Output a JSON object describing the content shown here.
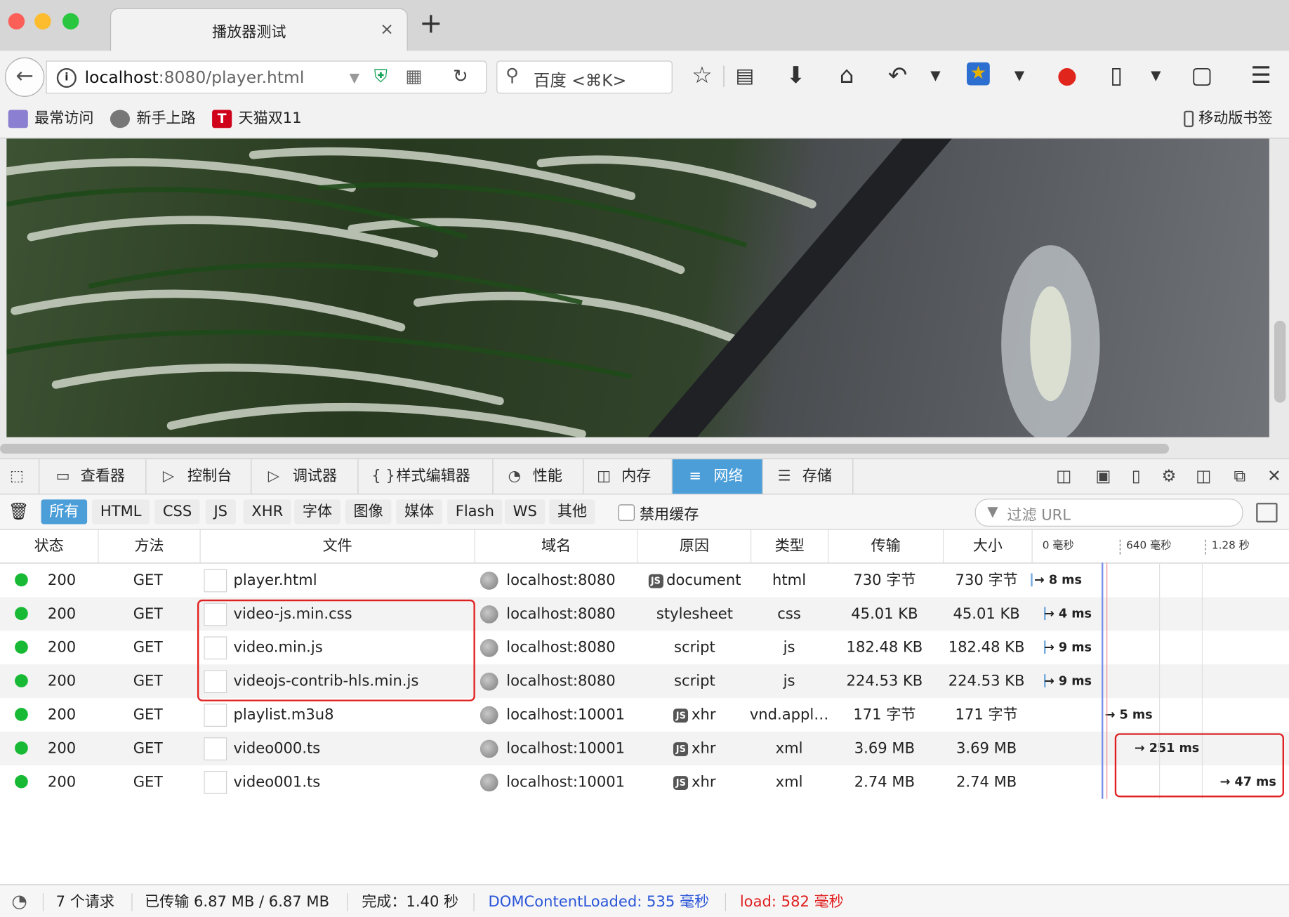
{
  "window": {
    "tab_title": "播放器测试",
    "tab_close": "×",
    "new_tab": "+"
  },
  "navbar": {
    "url_host": "localhost",
    "url_rest": ":8080/player.html",
    "search_placeholder": "百度 <⌘K>",
    "icons": [
      "back-icon",
      "info-icon",
      "dropdown-icon",
      "shield-icon",
      "qr-code-icon",
      "reload-icon",
      "star-icon",
      "reading-list-icon",
      "download-icon",
      "home-icon",
      "undo-icon",
      "favorites-icon",
      "color-extension-icon",
      "clipboard-icon",
      "crop-icon",
      "menu-icon"
    ]
  },
  "bookmarks": {
    "items": [
      "最常访问",
      "新手上路",
      "天猫双11"
    ],
    "mobile": "移动版书签"
  },
  "devtools": {
    "tabs": [
      {
        "label": "查看器",
        "icon": "inspector-icon"
      },
      {
        "label": "控制台",
        "icon": "console-icon"
      },
      {
        "label": "调试器",
        "icon": "debugger-icon"
      },
      {
        "label": "样式编辑器",
        "icon": "style-editor-icon"
      },
      {
        "label": "性能",
        "icon": "performance-icon"
      },
      {
        "label": "内存",
        "icon": "memory-icon"
      },
      {
        "label": "网络",
        "icon": "network-icon"
      },
      {
        "label": "存储",
        "icon": "storage-icon"
      }
    ],
    "active_tab": "网络",
    "filters": [
      "所有",
      "HTML",
      "CSS",
      "JS",
      "XHR",
      "字体",
      "图像",
      "媒体",
      "Flash",
      "WS",
      "其他"
    ],
    "disable_cache_label": "禁用缓存",
    "filter_placeholder": "过滤 URL",
    "columns": [
      "状态",
      "方法",
      "文件",
      "域名",
      "原因",
      "类型",
      "传输",
      "大小"
    ],
    "timeline_ticks": [
      "0 毫秒",
      "640 毫秒",
      "1.28 秒"
    ],
    "requests": [
      {
        "status": "200",
        "method": "GET",
        "file": "player.html",
        "domain": "localhost:8080",
        "cause": "document",
        "cause_js": true,
        "type": "html",
        "transferred": "730 字节",
        "size": "730 字节",
        "timing": "→ 8 ms"
      },
      {
        "status": "200",
        "method": "GET",
        "file": "video-js.min.css",
        "domain": "localhost:8080",
        "cause": "stylesheet",
        "cause_js": false,
        "type": "css",
        "transferred": "45.01 KB",
        "size": "45.01 KB",
        "timing": "→ 4 ms"
      },
      {
        "status": "200",
        "method": "GET",
        "file": "video.min.js",
        "domain": "localhost:8080",
        "cause": "script",
        "cause_js": false,
        "type": "js",
        "transferred": "182.48 KB",
        "size": "182.48 KB",
        "timing": "→ 9 ms"
      },
      {
        "status": "200",
        "method": "GET",
        "file": "videojs-contrib-hls.min.js",
        "domain": "localhost:8080",
        "cause": "script",
        "cause_js": false,
        "type": "js",
        "transferred": "224.53 KB",
        "size": "224.53 KB",
        "timing": "→ 9 ms"
      },
      {
        "status": "200",
        "method": "GET",
        "file": "playlist.m3u8",
        "domain": "localhost:10001",
        "cause": "xhr",
        "cause_js": true,
        "type": "vnd.appl…",
        "transferred": "171 字节",
        "size": "171 字节",
        "timing": "→ 5 ms"
      },
      {
        "status": "200",
        "method": "GET",
        "file": "video000.ts",
        "domain": "localhost:10001",
        "cause": "xhr",
        "cause_js": true,
        "type": "xml",
        "transferred": "3.69 MB",
        "size": "3.69 MB",
        "timing": "→ 251 ms"
      },
      {
        "status": "200",
        "method": "GET",
        "file": "video001.ts",
        "domain": "localhost:10001",
        "cause": "xhr",
        "cause_js": true,
        "type": "xml",
        "transferred": "2.74 MB",
        "size": "2.74 MB",
        "timing": "→ 47 ms"
      }
    ],
    "status": {
      "requests": "7 个请求",
      "transferred": "已传输 6.87 MB / 6.87 MB",
      "finish": "完成：1.40 秒",
      "dom_content_loaded": "DOMContentLoaded: 535 毫秒",
      "load": "load: 582 毫秒"
    },
    "colors": {
      "dcl": "#2a56d8",
      "load": "#e02020",
      "accent": "#4c9ed9",
      "status_ok": "#18b934"
    }
  }
}
